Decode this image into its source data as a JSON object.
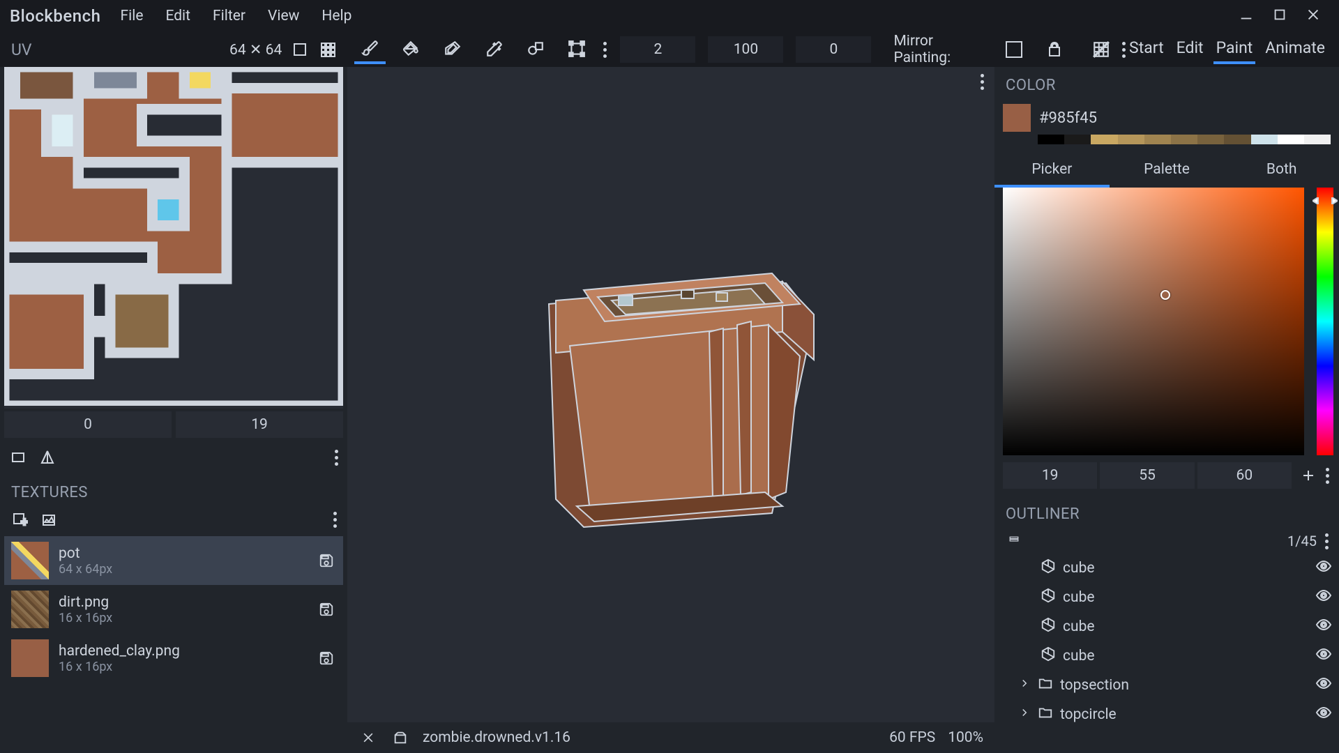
{
  "app": {
    "name": "Blockbench"
  },
  "menu": [
    "File",
    "Edit",
    "Filter",
    "View",
    "Help"
  ],
  "uv": {
    "label": "UV",
    "size": "64 ✕ 64",
    "coord_x": "0",
    "coord_y": "19"
  },
  "paint_tools": [
    "brush",
    "fill",
    "eraser",
    "color-picker",
    "shape",
    "transform"
  ],
  "brush": {
    "size": "2",
    "opacity": "100",
    "softness": "0"
  },
  "mirror": {
    "label": "Mirror Painting:"
  },
  "modes": [
    "Start",
    "Edit",
    "Paint",
    "Animate"
  ],
  "active_mode": "Paint",
  "textures": {
    "header": "TEXTURES",
    "items": [
      {
        "name": "pot",
        "dim": "64 x 64px",
        "selected": true
      },
      {
        "name": "dirt.png",
        "dim": "16 x 16px",
        "selected": false
      },
      {
        "name": "hardened_clay.png",
        "dim": "16 x 16px",
        "selected": false
      }
    ]
  },
  "status": {
    "file": "zombie.drowned.v1.16",
    "fps": "60 FPS",
    "zoom": "100%"
  },
  "color": {
    "header": "COLOR",
    "hex": "#985f45",
    "tabs": [
      "Picker",
      "Palette",
      "Both"
    ],
    "active_tab": "Picker",
    "hsl": {
      "h": "19",
      "s": "55",
      "l": "60"
    },
    "palette": [
      "#000000",
      "#1a1a1a",
      "#c9a862",
      "#b5965a",
      "#a08450",
      "#8c7347",
      "#78623d",
      "#645134",
      "#cfe3eb",
      "#ffffff",
      "#f0f0f0"
    ]
  },
  "outliner": {
    "header": "OUTLINER",
    "count": "1/45",
    "items": [
      {
        "type": "cube",
        "name": "cube",
        "indent": 1
      },
      {
        "type": "cube",
        "name": "cube",
        "indent": 1
      },
      {
        "type": "cube",
        "name": "cube",
        "indent": 1
      },
      {
        "type": "cube",
        "name": "cube",
        "indent": 1
      },
      {
        "type": "folder",
        "name": "topsection",
        "indent": 0
      },
      {
        "type": "folder",
        "name": "topcircle",
        "indent": 0
      }
    ]
  }
}
